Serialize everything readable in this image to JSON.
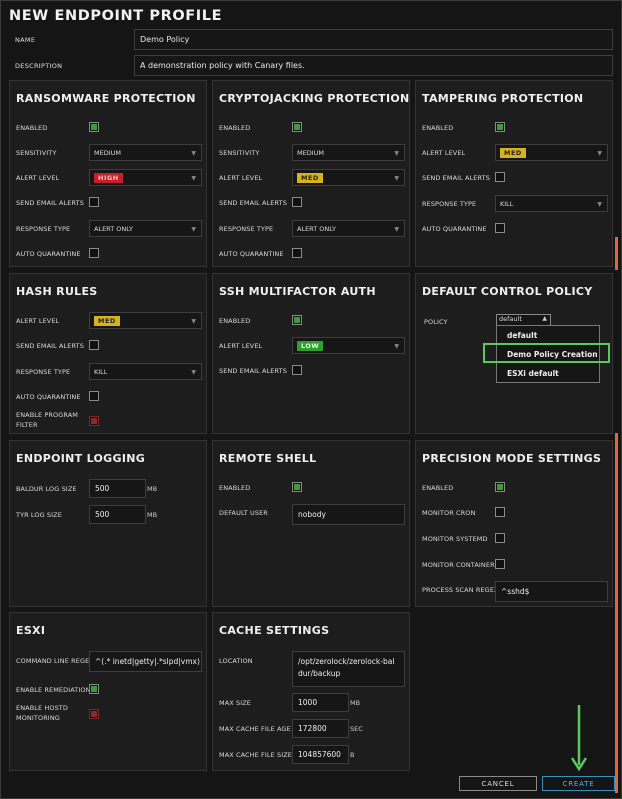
{
  "dialog": {
    "title": "NEW ENDPOINT PROFILE"
  },
  "form": {
    "name_label": "NAME",
    "name_value": "Demo Policy",
    "description_label": "DESCRIPTION",
    "description_value": "A demonstration policy with Canary files."
  },
  "labels": {
    "enabled": "ENABLED",
    "sensitivity": "SENSITIVITY",
    "alert_level": "ALERT LEVEL",
    "send_email_alerts": "SEND EMAIL ALERTS",
    "response_type": "RESPONSE TYPE",
    "auto_quarantine": "AUTO QUARANTINE",
    "policy": "POLICY",
    "default_user": "DEFAULT USER"
  },
  "ransomware": {
    "title": "RANSOMWARE PROTECTION",
    "enabled": true,
    "sensitivity": "MEDIUM",
    "alert_level": "HIGH",
    "send_email": false,
    "response_type": "ALERT ONLY",
    "auto_quarantine": false
  },
  "cryptojacking": {
    "title": "CRYPTOJACKING PROTECTION",
    "enabled": true,
    "sensitivity": "MEDIUM",
    "alert_level": "MED",
    "send_email": false,
    "response_type": "ALERT ONLY",
    "auto_quarantine": false
  },
  "tampering": {
    "title": "TAMPERING PROTECTION",
    "enabled": true,
    "alert_level": "MED",
    "send_email": false,
    "response_type": "KILL",
    "auto_quarantine": false
  },
  "hash_rules": {
    "title": "HASH RULES",
    "alert_level": "MED",
    "send_email": false,
    "response_type": "KILL",
    "auto_quarantine": false,
    "program_filter_label": "ENABLE PROGRAM FILTER",
    "program_filter": false
  },
  "ssh_mfa": {
    "title": "SSH MULTIFACTOR AUTH",
    "enabled": true,
    "alert_level": "LOW",
    "send_email": false
  },
  "default_control": {
    "title": "DEFAULT CONTROL POLICY",
    "policy_value": "default",
    "options": [
      "default",
      "Demo Policy Creation",
      "ESXi default"
    ],
    "highlighted_option": "Demo Policy Creation"
  },
  "endpoint_logging": {
    "title": "ENDPOINT LOGGING",
    "baldur_label": "BALDUR LOG SIZE",
    "baldur_value": "500",
    "tyr_label": "TYR LOG SIZE",
    "tyr_value": "500",
    "unit": "MB"
  },
  "remote_shell": {
    "title": "REMOTE SHELL",
    "enabled": true,
    "default_user": "nobody"
  },
  "precision_mode": {
    "title": "PRECISION MODE SETTINGS",
    "enabled": true,
    "monitor_cron_label": "MONITOR CRON",
    "monitor_systemd_label": "MONITOR SYSTEMD",
    "monitor_containerd_label": "MONITOR CONTAINERD",
    "process_scan_label": "PROCESS SCAN REGEX",
    "process_scan_value": "^sshd$"
  },
  "esxi": {
    "title": "ESXI",
    "cmdline_label": "COMMAND LINE REGEX",
    "cmdline_value": "^(.* inetd|getty|.*slpd|vmx) .*$",
    "remediation_label": "ENABLE REMEDIATION",
    "remediation": true,
    "hostd_label": "ENABLE HOSTD MONITORING",
    "hostd": false
  },
  "cache": {
    "title": "CACHE SETTINGS",
    "location_label": "LOCATION",
    "location_value": "/opt/zerolock/zerolock-baldur/backup",
    "max_size_label": "MAX SIZE",
    "max_size_value": "1000",
    "max_size_unit": "MB",
    "max_age_label": "MAX CACHE FILE AGE",
    "max_age_value": "172800",
    "max_age_unit": "SEC",
    "max_file_label": "MAX CACHE FILE SIZE",
    "max_file_value": "104857600",
    "max_file_unit": "B"
  },
  "buttons": {
    "cancel": "CANCEL",
    "create": "CREATE"
  },
  "colors": {
    "enabled_check": "#3e9b3e",
    "high": "#c4202a",
    "med": "#d5b21e",
    "low": "#2fa02f",
    "highlight_box": "#5cc85c",
    "arrow": "#5cc85c",
    "create_text": "#4fb6e8",
    "scrollbar": "#d86a3d"
  }
}
